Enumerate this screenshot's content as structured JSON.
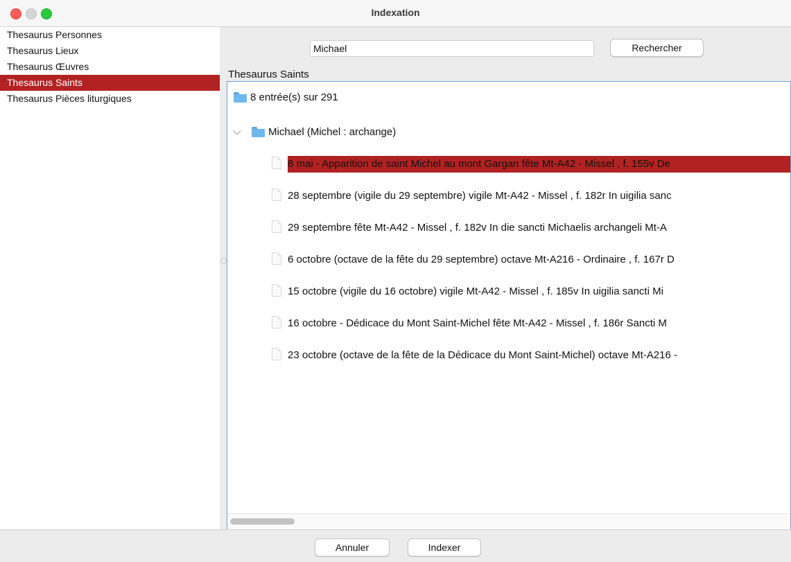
{
  "window": {
    "title": "Indexation"
  },
  "sidebar": {
    "items": [
      {
        "label": "Thesaurus Personnes",
        "selected": false
      },
      {
        "label": "Thesaurus Lieux",
        "selected": false
      },
      {
        "label": "Thesaurus Œuvres",
        "selected": false
      },
      {
        "label": "Thesaurus Saints",
        "selected": true
      },
      {
        "label": "Thesaurus Pièces liturgiques",
        "selected": false
      }
    ]
  },
  "search": {
    "value": "Michael",
    "button_label": "Rechercher"
  },
  "section": {
    "label": "Thesaurus Saints"
  },
  "tree": {
    "root_label": "8 entrée(s) sur 291",
    "node_label": "Michael (Michel : archange)",
    "leaves": [
      "8 mai - Apparition de saint Michel au mont Gargan fête Mt-A42 - Missel , f. 155v De",
      "28 septembre (vigile du 29 septembre) vigile Mt-A42 - Missel , f. 182r In uigilia sanc",
      "29 septembre fête Mt-A42 - Missel , f. 182v In die sancti Michaelis archangeli Mt-A",
      "6 octobre (octave de la fête du 29 septembre) octave Mt-A216 - Ordinaire , f. 167r D",
      "15 octobre (vigile du 16 octobre) vigile Mt-A42 - Missel , f. 185v In uigilia sancti Mi",
      "16 octobre - Dédicace du Mont Saint-Michel fête Mt-A42 - Missel , f. 186r Sancti M",
      "23 octobre (octave de la fête de la Dédicace du Mont Saint-Michel) octave Mt-A216 -"
    ],
    "selected_leaf_index": 0
  },
  "footer": {
    "cancel_label": "Annuler",
    "index_label": "Indexer"
  },
  "colors": {
    "selection": "#b22222",
    "tree_border": "#6f9ed2",
    "folder": "#6db8ee"
  }
}
